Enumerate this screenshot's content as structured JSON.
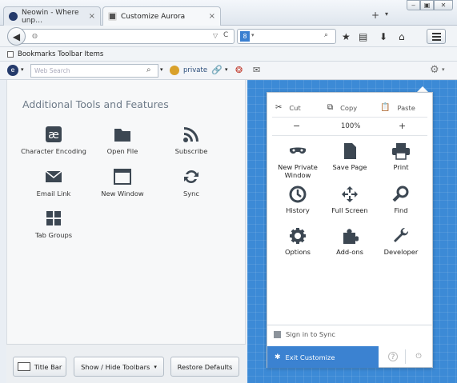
{
  "tabs": [
    {
      "title": "Neowin - Where unp…",
      "close": "×"
    },
    {
      "title": "Customize Aurora",
      "close": "×"
    }
  ],
  "tabbar": {
    "new_tab": "+",
    "list_tabs": "▾"
  },
  "window_controls": {
    "minimize": "‒",
    "restore": "▣",
    "close": "✕"
  },
  "navbar": {
    "back": "◀",
    "url_value": "",
    "url_dropdown": "▽",
    "reload": "C",
    "search_engine": "8",
    "search_engine_arrow": "▾",
    "search_placeholder": "",
    "search_icon": "🔍"
  },
  "bookmarks": {
    "label": "Bookmarks Toolbar Items"
  },
  "custombar": {
    "websearch_placeholder": "Web Search",
    "private_label": "private",
    "gear_arrow": "▾"
  },
  "palette": {
    "title": "Additional Tools and Features",
    "items": [
      {
        "label": "Character Encoding",
        "icon": "character-encoding-icon"
      },
      {
        "label": "Open File",
        "icon": "folder-icon"
      },
      {
        "label": "Subscribe",
        "icon": "rss-icon"
      },
      {
        "label": "Email Link",
        "icon": "envelope-icon"
      },
      {
        "label": "New Window",
        "icon": "window-icon"
      },
      {
        "label": "Sync",
        "icon": "sync-icon"
      },
      {
        "label": "Tab Groups",
        "icon": "grid-icon"
      }
    ]
  },
  "bottom_buttons": {
    "title_bar": "Title Bar",
    "toolbars": "Show / Hide Toolbars",
    "toolbars_arrow": "▾",
    "restore": "Restore Defaults"
  },
  "menu_panel": {
    "edit": {
      "cut": "Cut",
      "copy": "Copy",
      "paste": "Paste"
    },
    "zoom": {
      "minus": "−",
      "level": "100%",
      "plus": "+"
    },
    "items": [
      {
        "label": "New Private Window",
        "icon": "mask-icon"
      },
      {
        "label": "Save Page",
        "icon": "page-icon"
      },
      {
        "label": "Print",
        "icon": "printer-icon"
      },
      {
        "label": "History",
        "icon": "clock-icon"
      },
      {
        "label": "Full Screen",
        "icon": "fullscreen-icon"
      },
      {
        "label": "Find",
        "icon": "magnifier-icon"
      },
      {
        "label": "Options",
        "icon": "gear-icon"
      },
      {
        "label": "Add-ons",
        "icon": "puzzle-icon"
      },
      {
        "label": "Developer",
        "icon": "wrench-icon"
      }
    ],
    "sign_in": "Sign in to Sync",
    "exit": "Exit Customize",
    "help": "?",
    "quit": "⏻"
  },
  "colors": {
    "accent_blue": "#3c8ad6",
    "exit_blue": "#3b82d1"
  }
}
